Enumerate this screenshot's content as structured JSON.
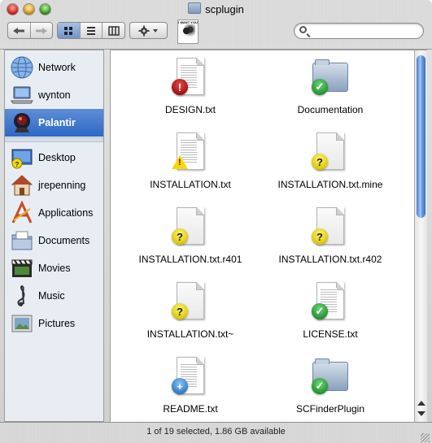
{
  "window": {
    "title": "scplugin",
    "status": "1 of 19 selected, 1.86 GB available"
  },
  "toolbar": {
    "back_icon": "back-arrow-icon",
    "forward_icon": "forward-arrow-icon",
    "view_modes": [
      "icon-view",
      "list-view",
      "column-view"
    ],
    "active_view": "icon-view",
    "action_icon": "gear-icon",
    "search": {
      "value": "",
      "placeholder": ""
    },
    "image_text": "I WANT YOU"
  },
  "sidebar": {
    "devices": [
      {
        "label": "Network",
        "icon": "network-globe-icon"
      },
      {
        "label": "wynton",
        "icon": "laptop-icon"
      },
      {
        "label": "Palantir",
        "icon": "palantir-icon",
        "selected": true
      }
    ],
    "places": [
      {
        "label": "Desktop",
        "icon": "desktop-icon"
      },
      {
        "label": "jrepenning",
        "icon": "home-icon"
      },
      {
        "label": "Applications",
        "icon": "applications-icon"
      },
      {
        "label": "Documents",
        "icon": "documents-icon"
      },
      {
        "label": "Movies",
        "icon": "movies-icon"
      },
      {
        "label": "Music",
        "icon": "music-icon"
      },
      {
        "label": "Pictures",
        "icon": "pictures-icon"
      }
    ]
  },
  "files": [
    {
      "name": "DESIGN.txt",
      "type": "text-document",
      "status": "conflict"
    },
    {
      "name": "Documentation",
      "type": "folder",
      "status": "normal"
    },
    {
      "name": "INSTALLATION.txt",
      "type": "text-document",
      "status": "warning"
    },
    {
      "name": "INSTALLATION.txt.mine",
      "type": "document",
      "status": "unversioned"
    },
    {
      "name": "INSTALLATION.txt.r401",
      "type": "document",
      "status": "unversioned"
    },
    {
      "name": "INSTALLATION.txt.r402",
      "type": "document",
      "status": "unversioned"
    },
    {
      "name": "INSTALLATION.txt~",
      "type": "document",
      "status": "unversioned"
    },
    {
      "name": "LICENSE.txt",
      "type": "text-document",
      "status": "normal"
    },
    {
      "name": "README.txt",
      "type": "text-document",
      "status": "added"
    },
    {
      "name": "SCFinderPlugin",
      "type": "folder",
      "status": "normal"
    }
  ],
  "colors": {
    "selection": "#2e67c4",
    "sidebar_bg": "#e8edf4",
    "scroll_thumb": "#4a7ccc"
  }
}
